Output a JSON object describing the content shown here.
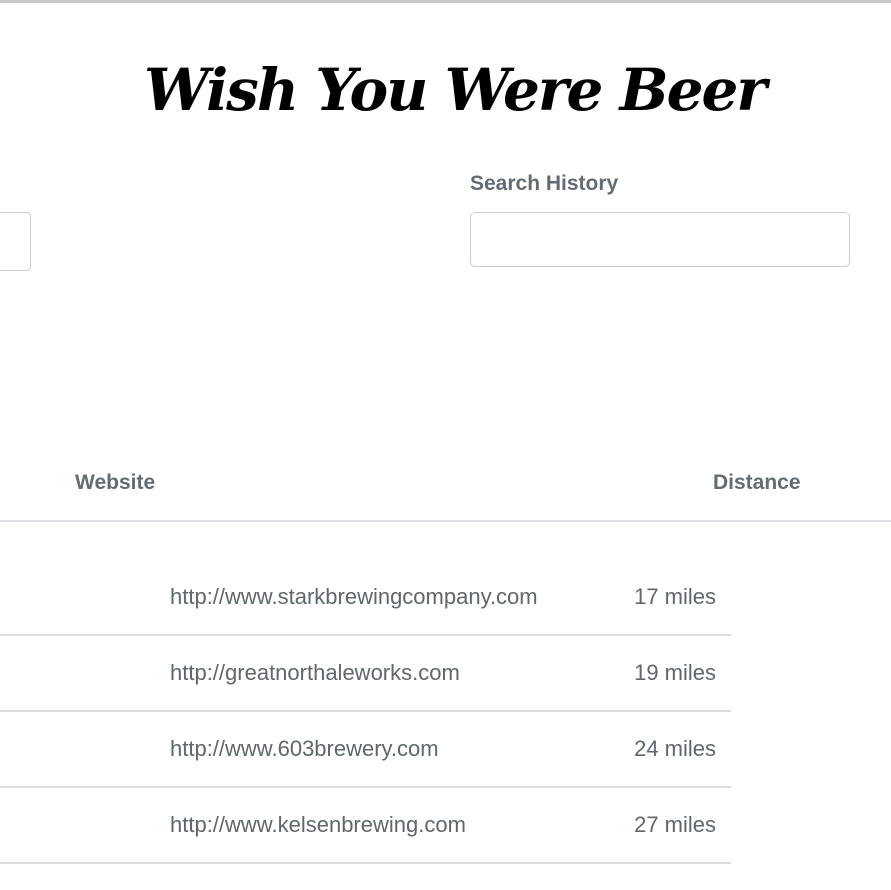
{
  "header": {
    "title": "Wish You Were Beer"
  },
  "search": {
    "history_label": "Search History",
    "history_value": "",
    "left_value": ""
  },
  "table": {
    "columns": {
      "website": "Website",
      "distance": "Distance"
    },
    "rows": [
      {
        "url": "http://www.starkbrewingcompany.com",
        "distance": "17 miles"
      },
      {
        "url": "http://greatnorthaleworks.com",
        "distance": "19 miles"
      },
      {
        "url": "http://www.603brewery.com",
        "distance": "24 miles"
      },
      {
        "url": "http://www.kelsenbrewing.com",
        "distance": "27 miles"
      }
    ]
  },
  "colors": {
    "label_gray": "#646b72",
    "text_gray": "#5f666d",
    "border": "#c9ced3"
  }
}
